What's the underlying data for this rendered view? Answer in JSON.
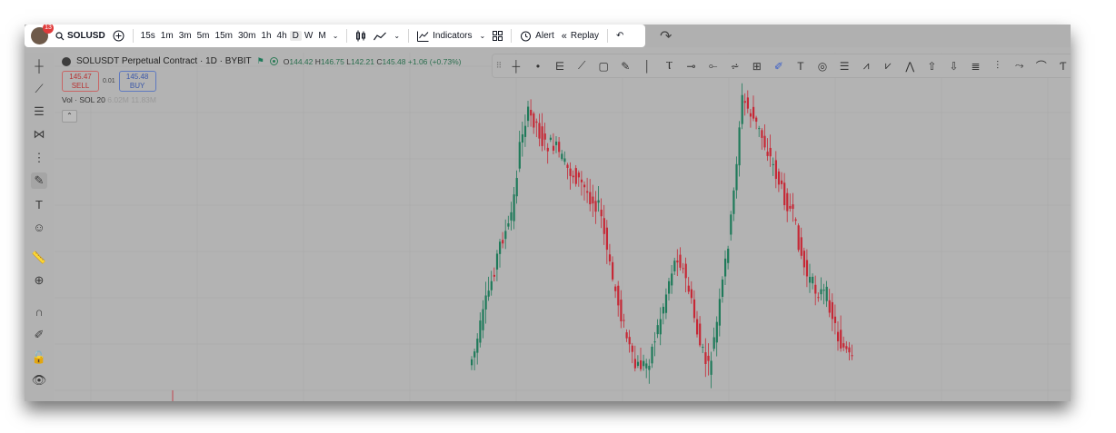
{
  "topbar": {
    "badge_count": "13",
    "symbol": "SOLUSD",
    "intervals": [
      "15s",
      "1m",
      "3m",
      "5m",
      "15m",
      "30m",
      "1h",
      "4h",
      "D",
      "W",
      "M"
    ],
    "active_interval": "D",
    "indicators_label": "Indicators",
    "alert_label": "Alert",
    "replay_label": "Replay"
  },
  "legend": {
    "title": "SOLUSDT Perpetual Contract · 1D · BYBIT",
    "o_label": "O",
    "o_value": "144.42",
    "h_label": "H",
    "h_value": "146.75",
    "l_label": "L",
    "l_value": "142.21",
    "c_label": "C",
    "c_value": "145.48",
    "change": "+1.06 (+0.73%)"
  },
  "trade": {
    "sell_price": "145.47",
    "sell_label": "SELL",
    "spread": "0.01",
    "buy_price": "145.48",
    "buy_label": "BUY"
  },
  "volume": {
    "label": "Vol · SOL 20",
    "value1": "6.02M",
    "value2": "11.83M"
  },
  "colors": {
    "up": "#1f7a5a",
    "down": "#c62836",
    "background": "#b3b3b3"
  },
  "icons": {
    "left_toolbar": [
      "crosshair-icon",
      "trend-line-icon",
      "fib-icon",
      "pattern-icon",
      "prediction-icon",
      "brush-icon",
      "text-icon",
      "emoji-icon",
      "ruler-icon",
      "zoom-in-icon",
      "magnet-icon",
      "lock-drawing-icon",
      "unlock-icon",
      "eye-icon"
    ],
    "drawing_toolbar": [
      "drag-handle-icon",
      "crosshair-icon",
      "dot-icon",
      "ray-icon",
      "line-icon",
      "rectangle-icon",
      "brush-icon",
      "vertical-line-icon",
      "text-cursor-icon",
      "horizontal-ray-icon",
      "horizontal-line-icon",
      "price-path-icon",
      "fixed-range-icon",
      "highlighter-icon",
      "text-icon",
      "circle-icon",
      "parallel-channel-icon",
      "abc-pattern-icon",
      "xabcd-pattern-icon",
      "elliott-wave-icon",
      "arrow-up-icon",
      "arrow-down-icon",
      "fib-channel-icon",
      "fib-retracement-icon",
      "path-icon",
      "curve-icon",
      "more-icon"
    ]
  }
}
